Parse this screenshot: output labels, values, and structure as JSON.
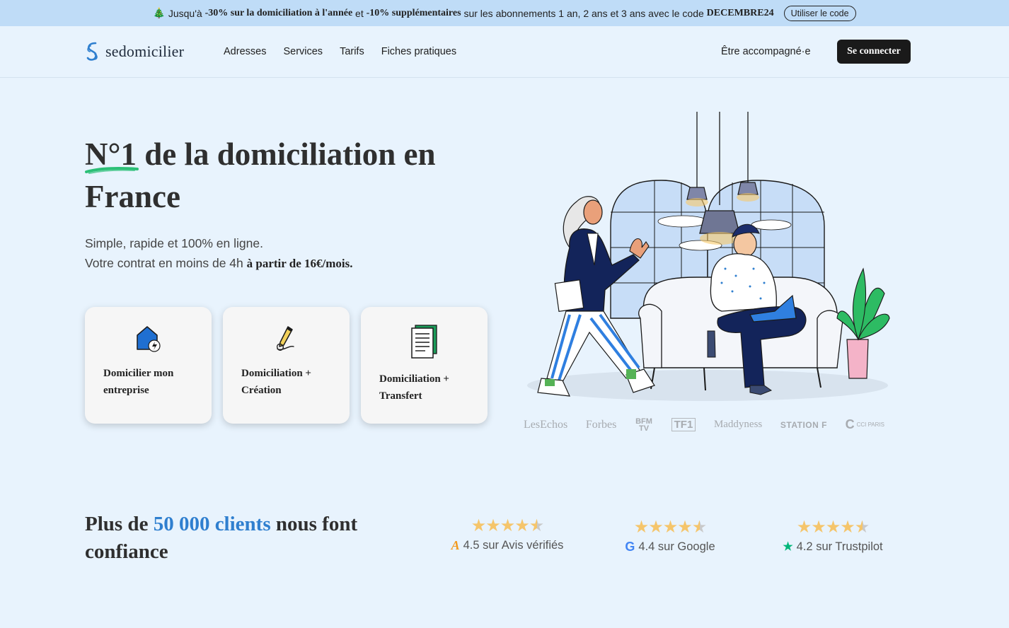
{
  "promo": {
    "tree_icon": "christmas-tree-icon",
    "text_1": "Jusqu'à ",
    "bold_1": "-30% sur la domiciliation à l'année",
    "text_2": " et ",
    "bold_2": "-10% supplémentaires",
    "text_3": " sur les abonnements 1 an, 2 ans et 3 ans avec le code ",
    "bold_3": "DECEMBRE24",
    "button": "Utiliser le code"
  },
  "header": {
    "logo": "sedomicilier",
    "nav": [
      "Adresses",
      "Services",
      "Tarifs",
      "Fiches pratiques"
    ],
    "accompany": "Être accompagné·e",
    "login": "Se connecter"
  },
  "hero": {
    "title_highlight": "N°1",
    "title_rest": " de la domiciliation en France",
    "subtitle_line1": "Simple, rapide et 100% en ligne.",
    "subtitle_line2": "Votre contrat en moins de 4h ",
    "subtitle_bold": "à partir de 16€/mois.",
    "cards": [
      {
        "label": "Domicilier mon entreprise",
        "icon": "house-lightning-icon"
      },
      {
        "label": "Domiciliation + Création",
        "icon": "pen-signature-icon"
      },
      {
        "label": "Domiciliation + Transfert",
        "icon": "documents-icon"
      }
    ]
  },
  "press": [
    "LesEchos",
    "Forbes",
    "BFM TV",
    "TF1",
    "Maddyness",
    "STATION F",
    "CCI PARIS"
  ],
  "trust": {
    "title_before": "Plus de ",
    "title_highlight": "50 000 clients",
    "title_after": " nous font confiance",
    "ratings": [
      {
        "score": 4.5,
        "text": "4.5 sur Avis vérifiés",
        "icon": "avis-verifies-icon",
        "color": "#f29a1f"
      },
      {
        "score": 4.4,
        "text": "4.4 sur Google",
        "icon": "google-icon",
        "color": "#4285f4"
      },
      {
        "score": 4.2,
        "text": "4.2 sur Trustpilot",
        "icon": "trustpilot-star-icon",
        "color": "#00b67a"
      }
    ]
  },
  "colors": {
    "background": "#e8f3fd",
    "banner": "#bfdcf7",
    "accent_blue": "#2f7fcf",
    "highlight_green": "#2bbf76",
    "star": "#f5c56b",
    "button_dark": "#1a1a1a"
  }
}
